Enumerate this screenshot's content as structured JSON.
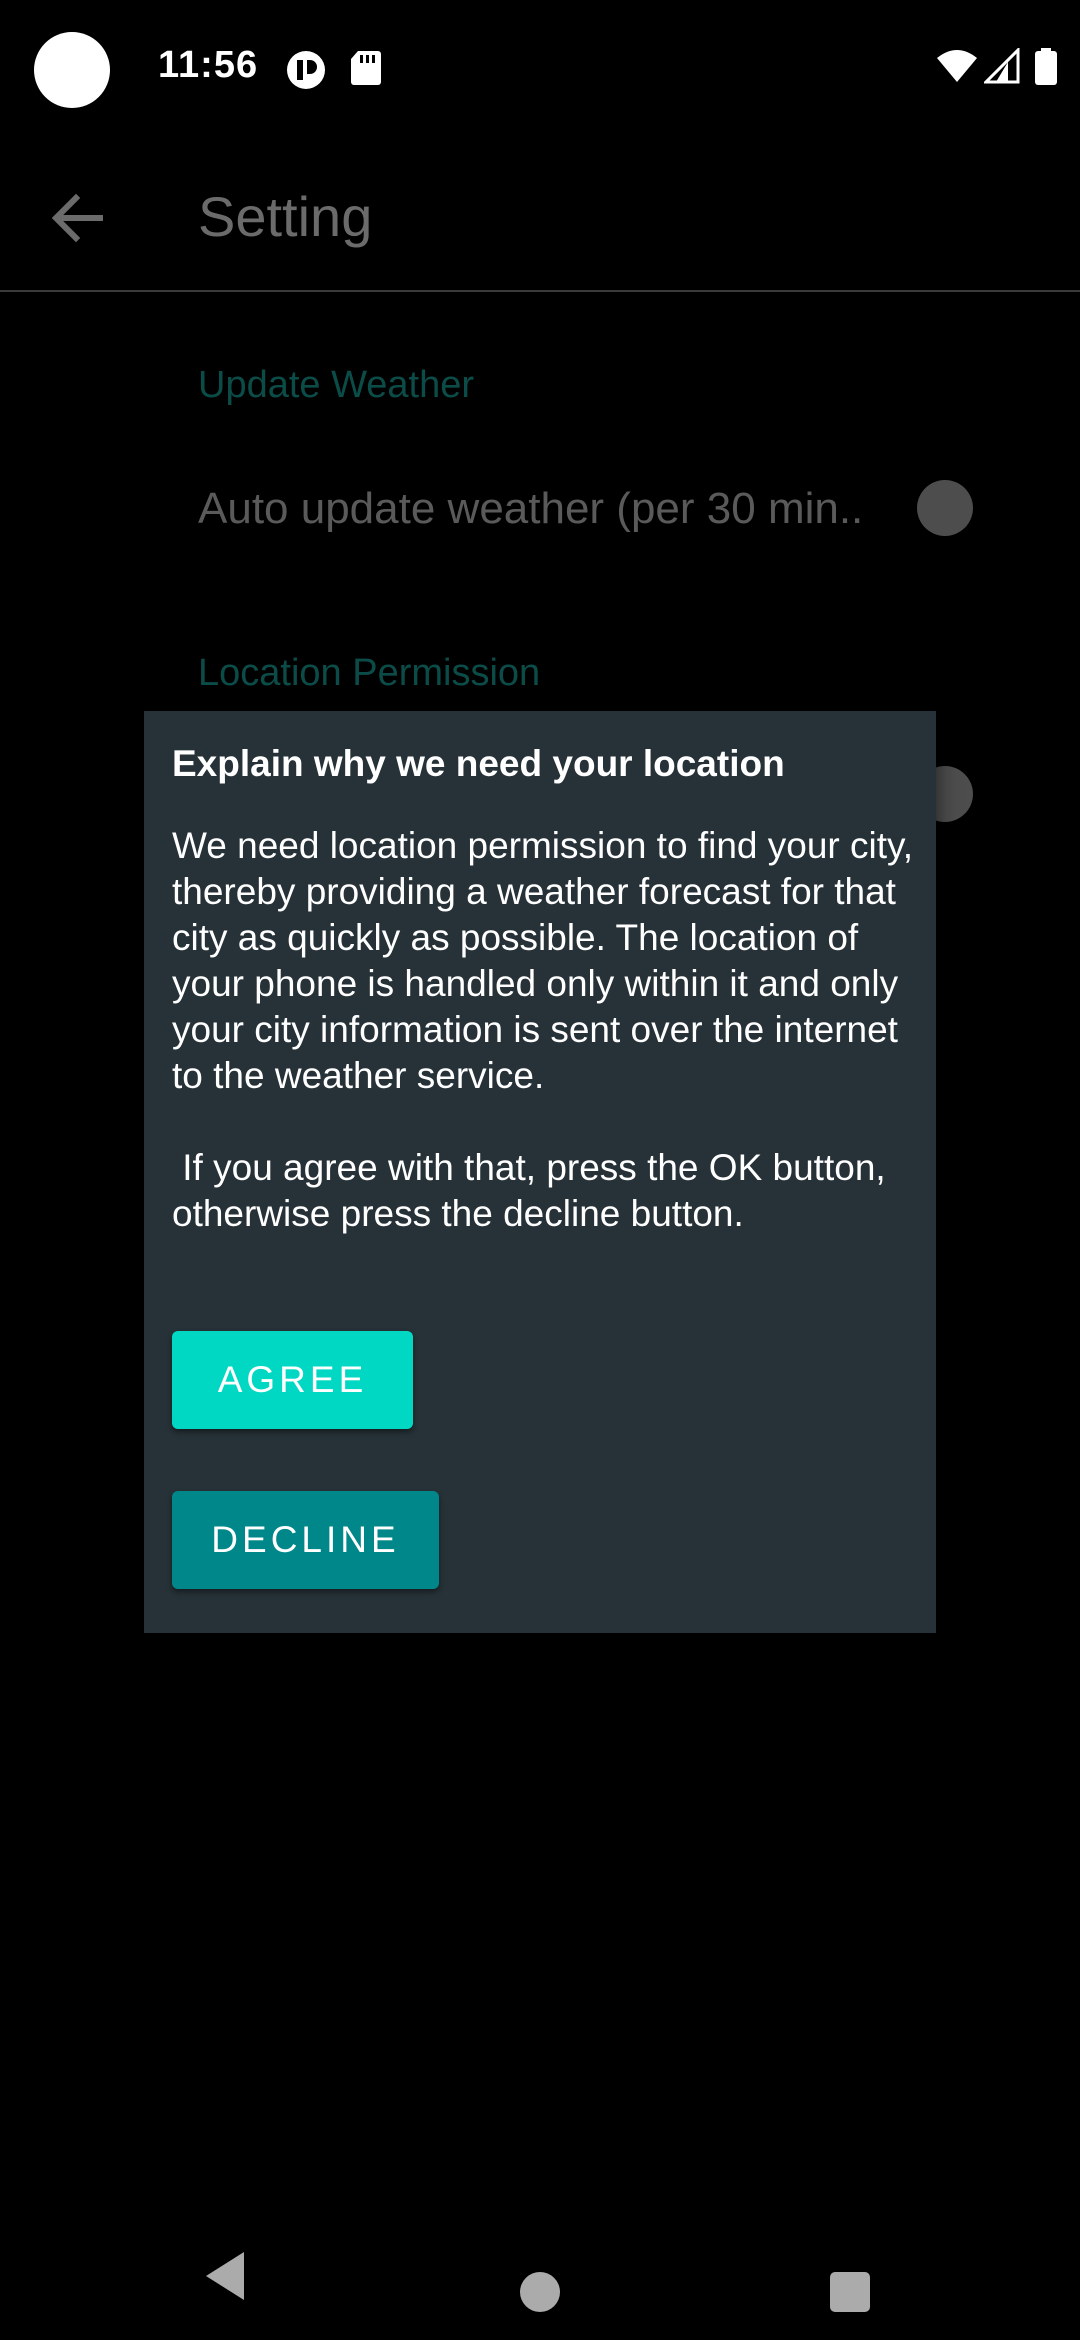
{
  "status_bar": {
    "time": "11:56",
    "left_icons": [
      "notification-app-icon",
      "sd-card-icon"
    ],
    "right_icons": [
      "wifi-icon",
      "signal-icon",
      "battery-icon"
    ]
  },
  "app_bar": {
    "title": "Setting",
    "back_icon": "arrow-back-icon"
  },
  "settings": {
    "update_section_header": "Update Weather",
    "auto_update_label": "Auto update weather (per 30 min..",
    "location_section_header": "Location Permission"
  },
  "dialog": {
    "title": "Explain why we need your location",
    "body": "We need location permission to find your city, thereby providing a weather forecast for that city as quickly as possible. The location of your phone is handled only within it and only your city information is sent over the internet to the weather service.\n\n If you agree with that, press the OK button, otherwise press the decline button.",
    "agree_label": "AGREE",
    "decline_label": "DECLINE"
  },
  "colors": {
    "dialog_background": "#263238",
    "agree_button": "#00d8c4",
    "decline_button": "#00878a",
    "section_header": "#0c4c48"
  },
  "nav_bar": {
    "icons": [
      "nav-back-icon",
      "nav-home-icon",
      "nav-recents-icon"
    ]
  }
}
